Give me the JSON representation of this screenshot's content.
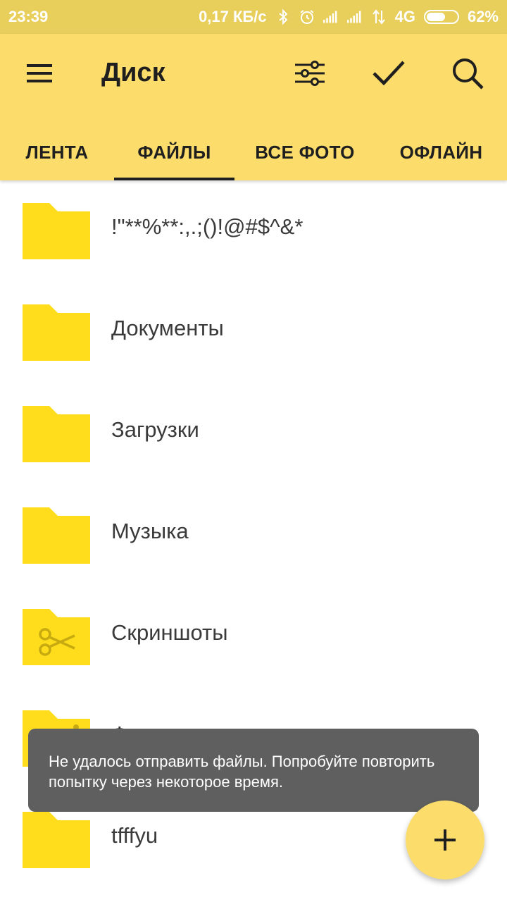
{
  "status_bar": {
    "time": "23:39",
    "network_speed": "0,17 КБ/с",
    "network_type": "4G",
    "battery_percent_label": "62%",
    "battery_level": 0.62,
    "icons": [
      "bluetooth-icon",
      "alarm-icon",
      "signal-icon",
      "signal-icon",
      "data-arrows-icon",
      "battery-icon"
    ]
  },
  "app_bar": {
    "title": "Диск",
    "actions": [
      "menu-icon",
      "filter-icon",
      "checkmark-icon",
      "search-icon"
    ],
    "tabs": [
      {
        "label": "ЛЕНТА",
        "active": false
      },
      {
        "label": "ФАЙЛЫ",
        "active": true
      },
      {
        "label": "ВСЕ ФОТО",
        "active": false
      },
      {
        "label": "ОФЛАЙН",
        "active": false
      }
    ]
  },
  "folders": [
    {
      "name": "!\"**%**:,.;()!@#$^&*",
      "icon": "folder-icon"
    },
    {
      "name": "Документы",
      "icon": "folder-icon"
    },
    {
      "name": "Загрузки",
      "icon": "folder-icon"
    },
    {
      "name": "Музыка",
      "icon": "folder-icon"
    },
    {
      "name": "Скриншоты",
      "icon": "folder-scissors-icon"
    },
    {
      "name": "Фотокамера",
      "icon": "folder-camera-icon"
    },
    {
      "name": "tfffyu",
      "icon": "folder-icon"
    }
  ],
  "snackbar": {
    "message": "Не удалось отправить файлы. Попробуйте повторить попытку через некоторое время."
  },
  "fab": {
    "icon": "plus-icon"
  },
  "colors": {
    "app_bar": "#fcdd6b",
    "status_bar": "#e8cf5c",
    "folder": "#ffdd1c",
    "snackbar": "#5f5f5f"
  }
}
